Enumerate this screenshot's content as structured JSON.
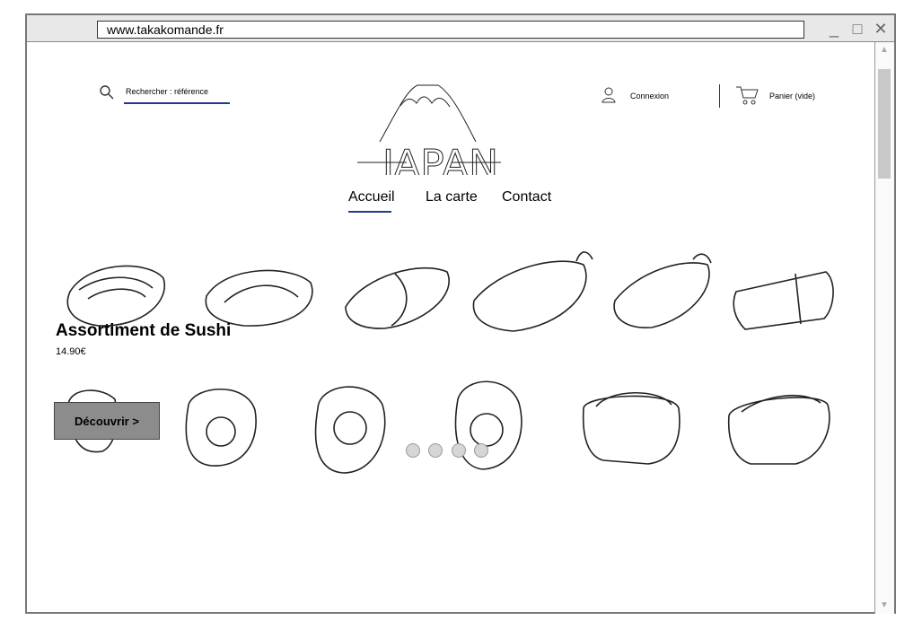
{
  "browser": {
    "url": "www.takakomande.fr",
    "minimize_icon": "minimize-icon",
    "maximize_icon": "maximize-icon",
    "close_icon": "close-icon"
  },
  "search": {
    "placeholder": "Rechercher : référence",
    "icon": "search-icon"
  },
  "logo": {
    "text": "JAPAN"
  },
  "account": {
    "login": "Connexion",
    "cart": "Panier (vide)",
    "login_icon": "user-icon",
    "cart_icon": "cart-icon"
  },
  "nav": {
    "items": [
      "Accueil",
      "La carte",
      "Contact"
    ],
    "active": "Accueil"
  },
  "hero": {
    "title": "Assortiment de Sushi",
    "price": "14.90€",
    "cta": "Découvrir >",
    "carousel_count": 4
  },
  "colors": {
    "accent": "#1f3c88",
    "button": "#8c8c8c"
  }
}
